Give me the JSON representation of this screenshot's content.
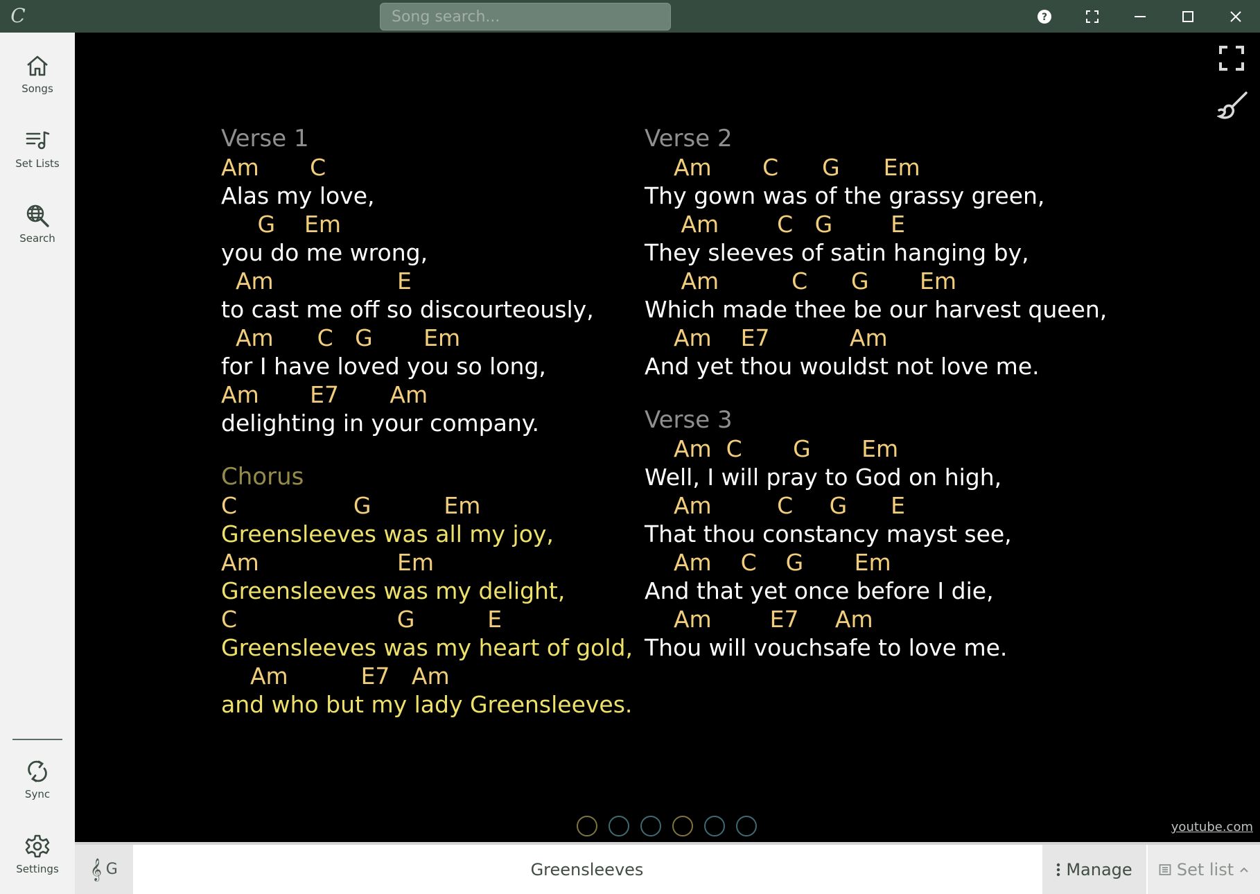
{
  "window": {
    "logo_glyph": "C",
    "search_placeholder": "Song search..."
  },
  "sidebar": {
    "items": [
      {
        "label": "Songs",
        "icon": "home-icon"
      },
      {
        "label": "Set Lists",
        "icon": "setlist-icon"
      },
      {
        "label": "Search",
        "icon": "web-search-icon"
      }
    ],
    "bottom_items": [
      {
        "label": "Sync",
        "icon": "sync-icon"
      },
      {
        "label": "Settings",
        "icon": "gear-icon"
      }
    ]
  },
  "song": {
    "title": "Greensleeves",
    "key": "G",
    "source": "youtube.com",
    "left_column": [
      {
        "title": "Verse 1",
        "type": "verse",
        "lines": [
          {
            "chords": "Am       C",
            "lyrics": "Alas my love,"
          },
          {
            "chords": "     G    Em",
            "lyrics": "you do me wrong,"
          },
          {
            "chords": "  Am                 E",
            "lyrics": "to cast me off so discourteously,"
          },
          {
            "chords": "  Am      C   G       Em",
            "lyrics": "for I have loved you so long,"
          },
          {
            "chords": "Am       E7       Am",
            "lyrics": "delighting in your company."
          }
        ]
      },
      {
        "title": "Chorus",
        "type": "chorus",
        "lines": [
          {
            "chords": "C                G          Em",
            "lyrics": "Greensleeves was all my joy,"
          },
          {
            "chords": "Am                   Em",
            "lyrics": "Greensleeves was my delight,"
          },
          {
            "chords": "C                      G          E",
            "lyrics": "Greensleeves was my heart of gold,"
          },
          {
            "chords": "    Am          E7   Am",
            "lyrics": "and who but my lady Greensleeves."
          }
        ]
      }
    ],
    "right_column": [
      {
        "title": "Verse 2",
        "type": "verse",
        "lines": [
          {
            "chords": "    Am       C      G      Em",
            "lyrics": "Thy gown was of the grassy green,"
          },
          {
            "chords": "     Am        C   G        E",
            "lyrics": "They sleeves of satin hanging by,"
          },
          {
            "chords": "     Am          C      G       Em",
            "lyrics": "Which made thee be our harvest queen,"
          },
          {
            "chords": "    Am    E7           Am",
            "lyrics": "And yet thou wouldst not love me."
          }
        ]
      },
      {
        "title": "Verse 3",
        "type": "verse",
        "lines": [
          {
            "chords": "    Am  C       G       Em",
            "lyrics": "Well, I will pray to God on high,"
          },
          {
            "chords": "    Am         C     G      E",
            "lyrics": "That thou constancy mayst see,"
          },
          {
            "chords": "    Am    C    G       Em",
            "lyrics": "And that yet once before I die,"
          },
          {
            "chords": "    Am        E7     Am",
            "lyrics": "Thou will vouchsafe to love me."
          }
        ]
      }
    ]
  },
  "pager": {
    "dots": [
      "gold",
      "teal",
      "teal",
      "gold",
      "teal",
      "teal"
    ]
  },
  "bottombar": {
    "manage_label": "Manage",
    "setlist_label": "Set list"
  },
  "colors": {
    "titlebar": "#354b40",
    "section_title": "#8f8f8f",
    "chorus_title": "#958b49",
    "chord": "#f2cd7b",
    "lyric": "#ffffff",
    "chorus_lyric": "#eee16b"
  }
}
